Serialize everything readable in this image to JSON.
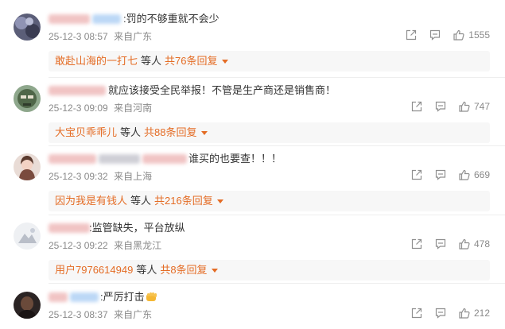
{
  "comments": [
    {
      "content": ":罚的不够重就不会少",
      "time": "25-12-3 08:57",
      "location": "来自广东",
      "likes": "1555",
      "reply": {
        "user": "敢赴山海的一打七",
        "mid": "等人",
        "total": "共76条回复"
      }
    },
    {
      "content": "就应该接受全民举报！不管是生产商还是销售商！",
      "time": "25-12-3 09:09",
      "location": "来自河南",
      "likes": "747",
      "reply": {
        "user": "大宝贝乖乖儿",
        "mid": "等人",
        "total": "共88条回复"
      }
    },
    {
      "content": "谁买的也要查！！！",
      "time": "25-12-3 09:32",
      "location": "来自上海",
      "likes": "669",
      "reply": {
        "user": "因为我是有钱人",
        "mid": "等人",
        "total": "共216条回复"
      }
    },
    {
      "content": ":监管缺失，平台放纵",
      "time": "25-12-3 09:22",
      "location": "来自黑龙江",
      "likes": "478",
      "reply": {
        "user": "用户7976614949",
        "mid": "等人",
        "total": "共8条回复"
      }
    },
    {
      "content": ":严厉打击",
      "time": "25-12-3 08:37",
      "location": "来自广东",
      "likes": "212"
    }
  ],
  "icons": {
    "share": "share-icon",
    "comment": "comment-icon",
    "like": "thumbs-up-icon",
    "emoji": "fist-emoji-icon",
    "caret": "caret-down-icon"
  },
  "colors": {
    "reply_link": "#e46c25",
    "meta_text": "#8a8a8a",
    "reply_bg": "#f7f7f7"
  }
}
